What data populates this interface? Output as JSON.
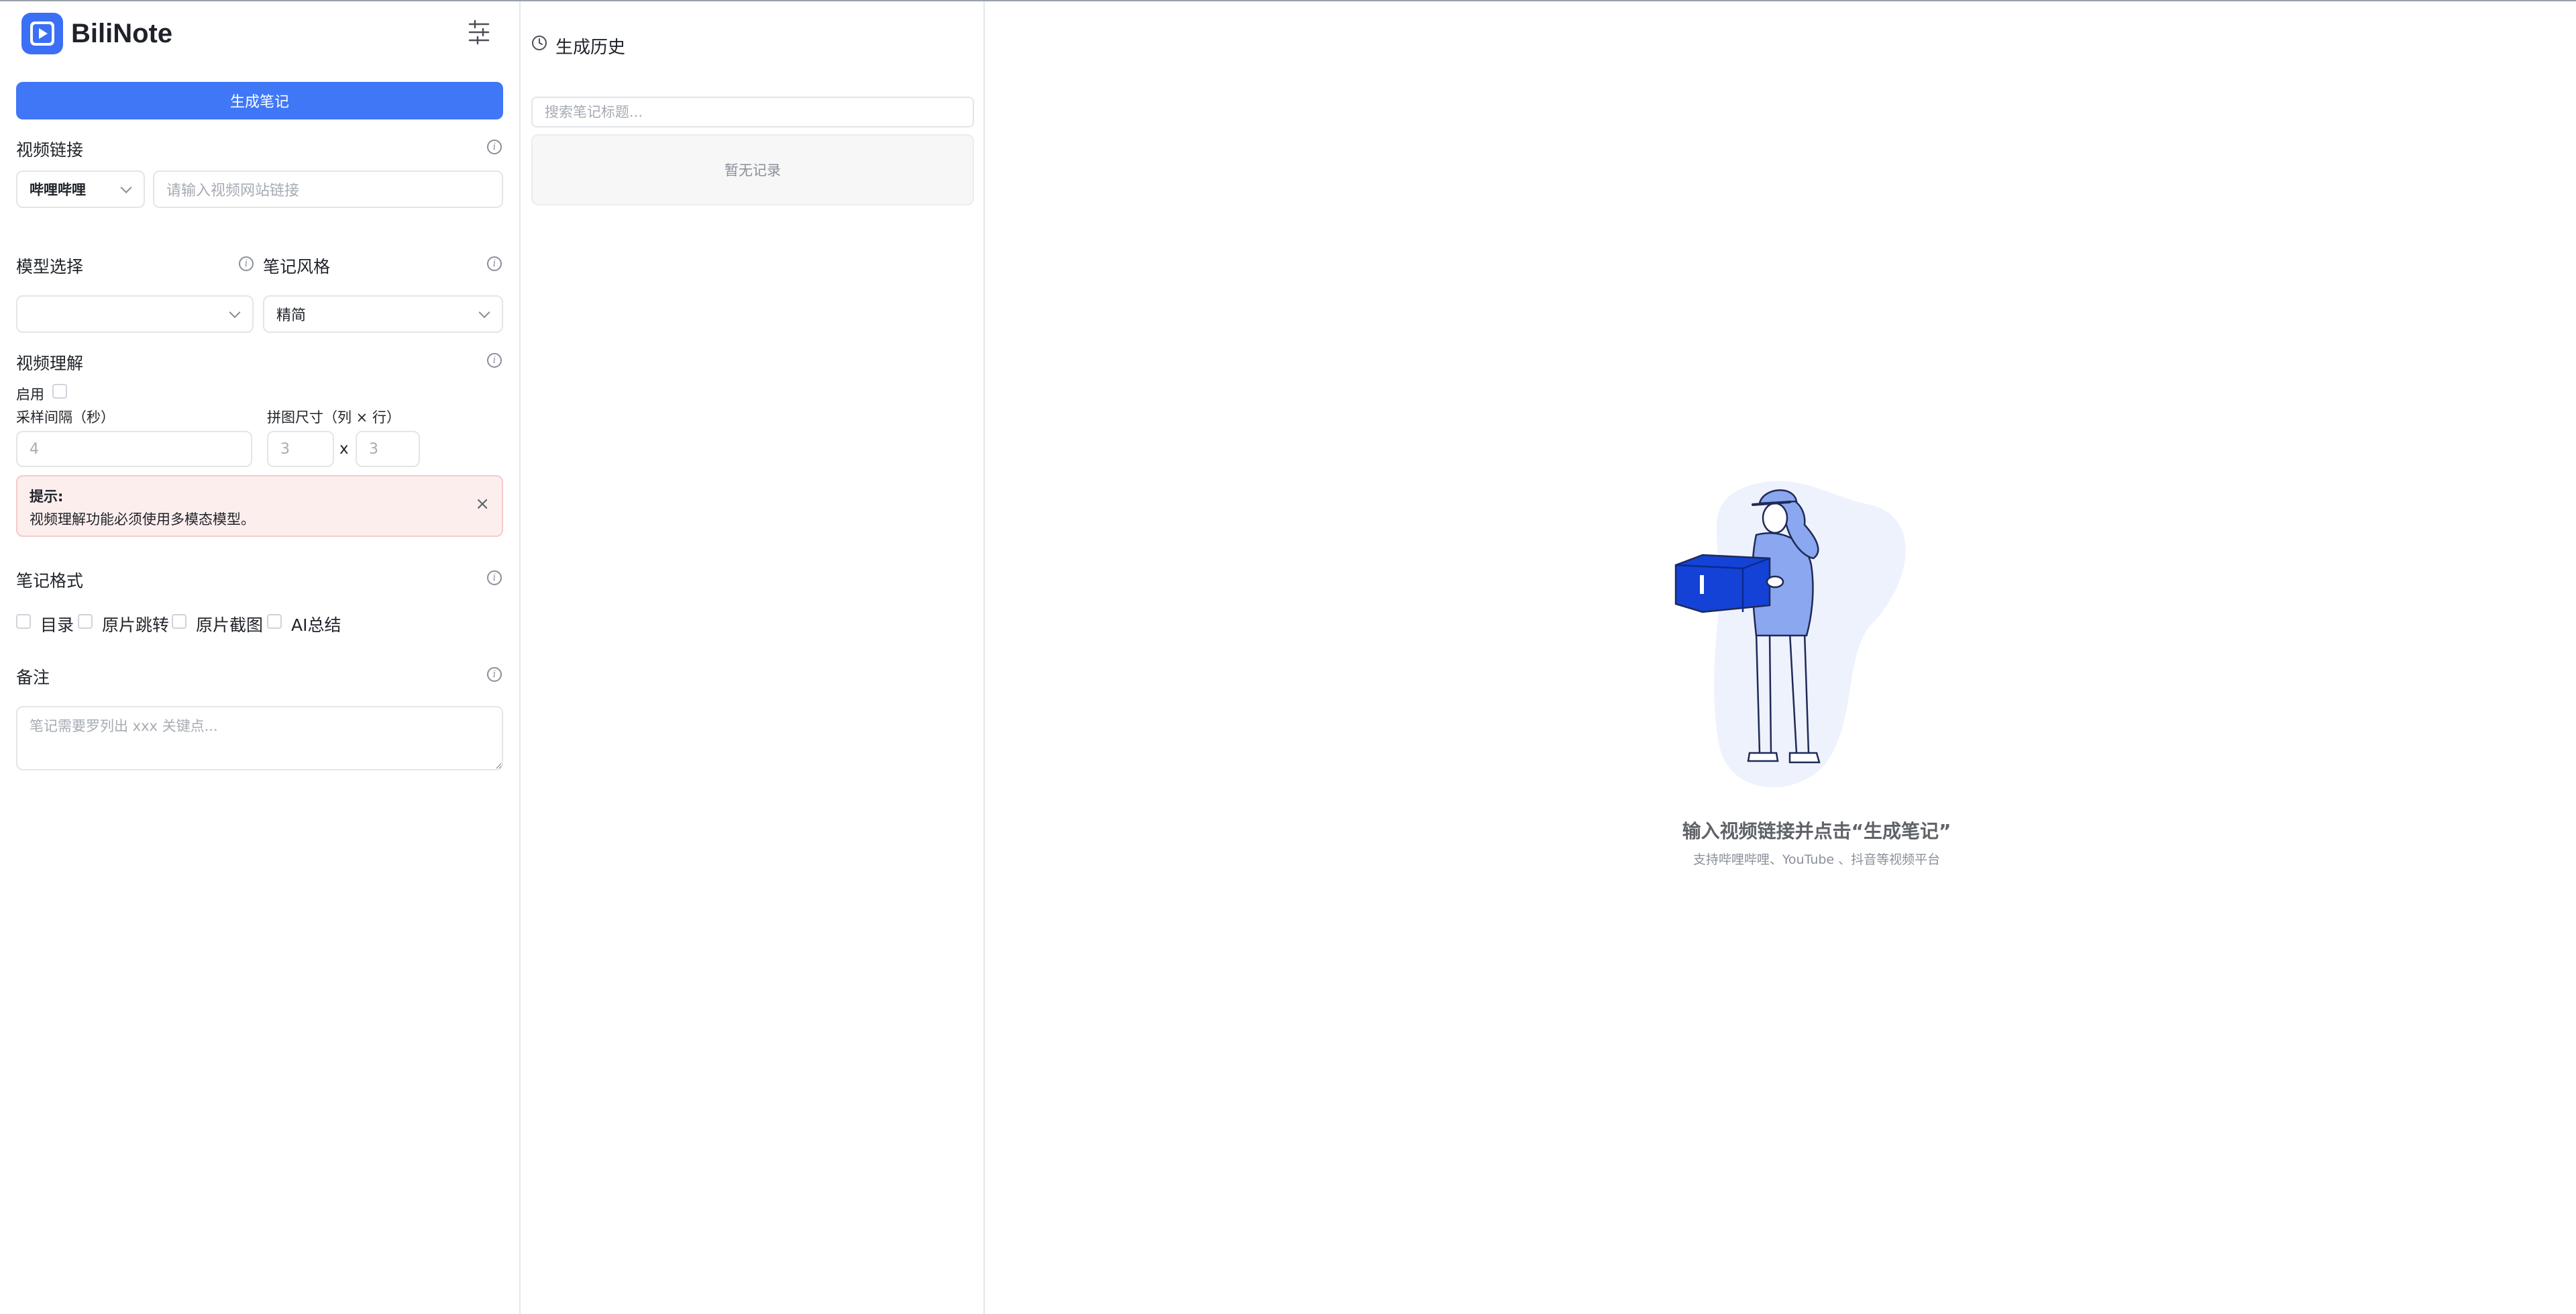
{
  "app": {
    "title": "BiliNote"
  },
  "form": {
    "generate_button": "生成笔记",
    "video_link": {
      "label": "视频链接",
      "platform_selected": "哔哩哔哩",
      "url_placeholder": "请输入视频网站链接"
    },
    "model": {
      "label": "模型选择",
      "selected": ""
    },
    "note_style": {
      "label": "笔记风格",
      "selected": "精简"
    },
    "video_understanding": {
      "label": "视频理解",
      "enable_label": "启用",
      "interval_label": "采样间隔（秒）",
      "interval_placeholder": "4",
      "grid_label": "拼图尺寸（列 × 行）",
      "cols_placeholder": "3",
      "times": "x",
      "rows_placeholder": "3"
    },
    "tip": {
      "title": "提示:",
      "text": "视频理解功能必须使用多模态模型。",
      "close": "×"
    },
    "note_format": {
      "label": "笔记格式",
      "options": [
        "目录",
        "原片跳转",
        "原片截图",
        "AI总结"
      ]
    },
    "remark": {
      "label": "备注",
      "placeholder": "笔记需要罗列出 xxx 关键点..."
    }
  },
  "history": {
    "title": "生成历史",
    "search_placeholder": "搜索笔记标题...",
    "empty_text": "暂无记录"
  },
  "main": {
    "empty_title": "输入视频链接并点击“生成笔记”",
    "empty_subtitle": "支持哔哩哔哩、YouTube 、抖音等视频平台"
  },
  "colors": {
    "primary": "#3f77f7",
    "tip_bg": "#fdeeee",
    "illustration_blue": "#1442d6",
    "illustration_light": "#eef2fd"
  }
}
